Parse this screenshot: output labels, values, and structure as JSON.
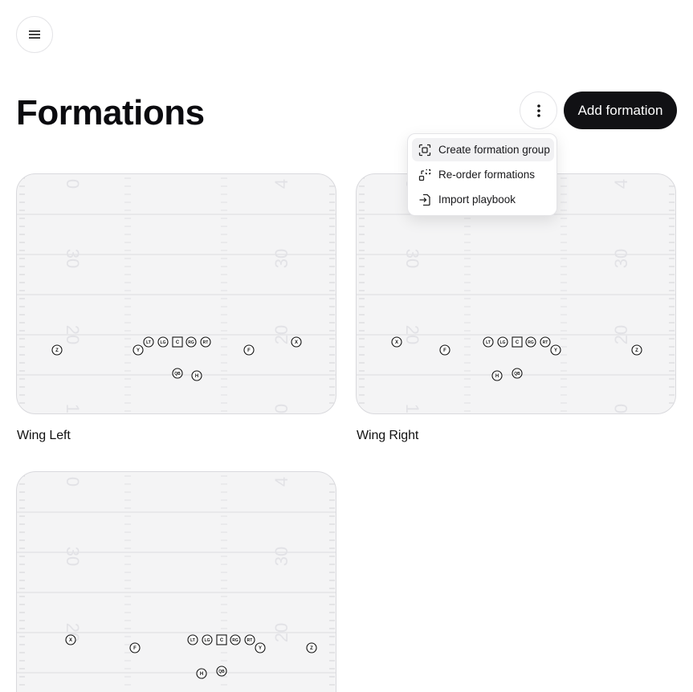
{
  "page": {
    "title": "Formations"
  },
  "header": {
    "add_label": "Add formation"
  },
  "dropdown": {
    "items": [
      {
        "label": "Create formation group",
        "icon": "group-icon"
      },
      {
        "label": "Re-order formations",
        "icon": "reorder-icon"
      },
      {
        "label": "Import playbook",
        "icon": "import-icon"
      }
    ]
  },
  "field_numbers": [
    "0",
    "30",
    "20",
    "1",
    "4",
    "30",
    "20",
    "0"
  ],
  "formations": [
    {
      "name": "Wing Left",
      "players": [
        "Z",
        "Y",
        "LT",
        "LG",
        "C",
        "RG",
        "RT",
        "F",
        "X",
        "QB",
        "H"
      ]
    },
    {
      "name": "Wing Right",
      "players": [
        "X",
        "F",
        "LT",
        "LG",
        "C",
        "RG",
        "RT",
        "Y",
        "Z",
        "H",
        "QB"
      ]
    },
    {
      "name": "",
      "players": [
        "X",
        "F",
        "LT",
        "LG",
        "C",
        "RG",
        "RT",
        "Y",
        "Z",
        "H",
        "QB"
      ]
    }
  ]
}
